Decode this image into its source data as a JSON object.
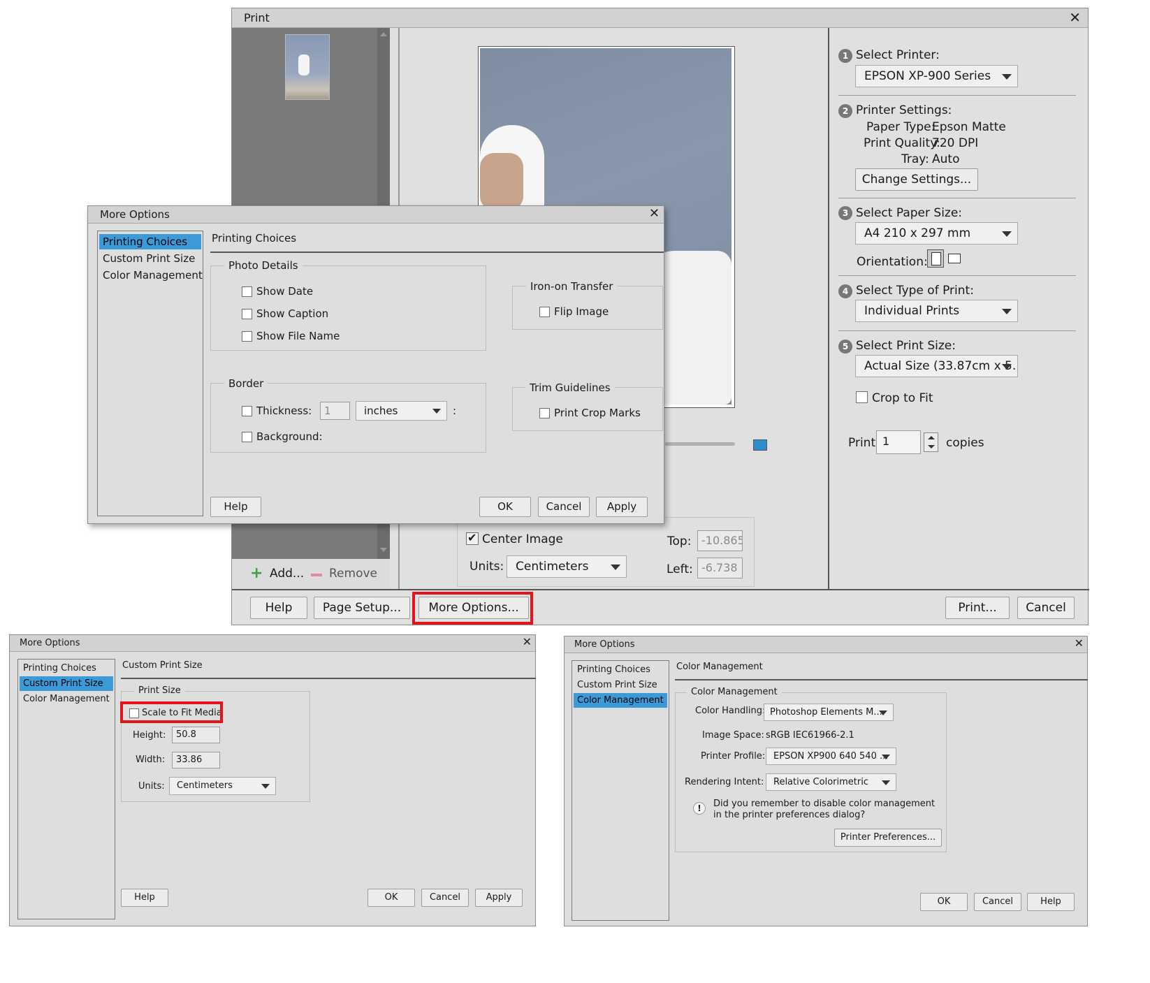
{
  "print_window": {
    "title": "Print",
    "add_label": "Add...",
    "remove_label": "Remove",
    "preview": {
      "center_image_label": "Center Image",
      "units_label": "Units:",
      "units_value": "Centimeters",
      "top_label": "Top:",
      "top_value": "-10.865",
      "left_label": "Left:",
      "left_value": "-6.738"
    },
    "panel": {
      "step1_num": "1",
      "select_printer_label": "Select Printer:",
      "printer_value": "EPSON XP-900 Series",
      "step2_num": "2",
      "printer_settings_label": "Printer Settings:",
      "paper_type_label": "Paper Type:",
      "paper_type_value": "Epson Matte",
      "print_quality_label": "Print Quality:",
      "print_quality_value": "720 DPI",
      "tray_label": "Tray:",
      "tray_value": "Auto",
      "change_settings_label": "Change Settings...",
      "step3_num": "3",
      "select_paper_size_label": "Select Paper Size:",
      "paper_size_value": "A4 210 x 297 mm",
      "orientation_label": "Orientation:",
      "step4_num": "4",
      "select_type_label": "Select Type of Print:",
      "type_value": "Individual Prints",
      "step5_num": "5",
      "select_print_size_label": "Select Print Size:",
      "print_size_value": "Actual Size (33.87cm x 5...",
      "crop_to_fit_label": "Crop to Fit",
      "print_label": "Print",
      "copies_value": "1",
      "copies_label": "copies"
    },
    "buttons": {
      "help": "Help",
      "page_setup": "Page Setup...",
      "more_options": "More Options...",
      "print": "Print...",
      "cancel": "Cancel"
    }
  },
  "more_options_main": {
    "title": "More Options",
    "sidebar": [
      "Printing Choices",
      "Custom Print Size",
      "Color Management"
    ],
    "heading": "Printing Choices",
    "photo_details": {
      "legend": "Photo Details",
      "show_date": "Show Date",
      "show_caption": "Show Caption",
      "show_file_name": "Show File Name"
    },
    "iron_on": {
      "legend": "Iron-on Transfer",
      "flip_image": "Flip Image"
    },
    "border": {
      "legend": "Border",
      "thickness_label": "Thickness:",
      "thickness_value": "1",
      "unit_value": "inches",
      "colon": ":",
      "background_label": "Background:"
    },
    "trim": {
      "legend": "Trim Guidelines",
      "print_crop_marks": "Print Crop Marks"
    },
    "buttons": {
      "help": "Help",
      "ok": "OK",
      "cancel": "Cancel",
      "apply": "Apply"
    }
  },
  "more_options_custom": {
    "title": "More Options",
    "sidebar": [
      "Printing Choices",
      "Custom Print Size",
      "Color Management"
    ],
    "heading": "Custom Print Size",
    "group_legend": "Print Size",
    "scale_to_fit_label": "Scale to Fit Media",
    "height_label": "Height:",
    "height_value": "50.8",
    "width_label": "Width:",
    "width_value": "33.86",
    "units_label": "Units:",
    "units_value": "Centimeters",
    "buttons": {
      "help": "Help",
      "ok": "OK",
      "cancel": "Cancel",
      "apply": "Apply"
    }
  },
  "more_options_color": {
    "title": "More Options",
    "sidebar": [
      "Printing Choices",
      "Custom Print Size",
      "Color Management"
    ],
    "heading": "Color Management",
    "group_legend": "Color Management",
    "color_handling_label": "Color Handling:",
    "color_handling_value": "Photoshop Elements M...",
    "image_space_label": "Image Space:",
    "image_space_value": "sRGB IEC61966-2.1",
    "printer_profile_label": "Printer Profile:",
    "printer_profile_value": "EPSON XP900 640 540 ...",
    "rendering_intent_label": "Rendering Intent:",
    "rendering_intent_value": "Relative Colorimetric",
    "warning_line1": "Did you remember to disable color management",
    "warning_line2": "in the printer preferences dialog?",
    "printer_preferences_label": "Printer Preferences...",
    "buttons": {
      "ok": "OK",
      "cancel": "Cancel",
      "help": "Help"
    }
  },
  "colors": {
    "highlight": "#e3141b",
    "selection": "#3c9ad9",
    "window_bg": "#dedede"
  }
}
